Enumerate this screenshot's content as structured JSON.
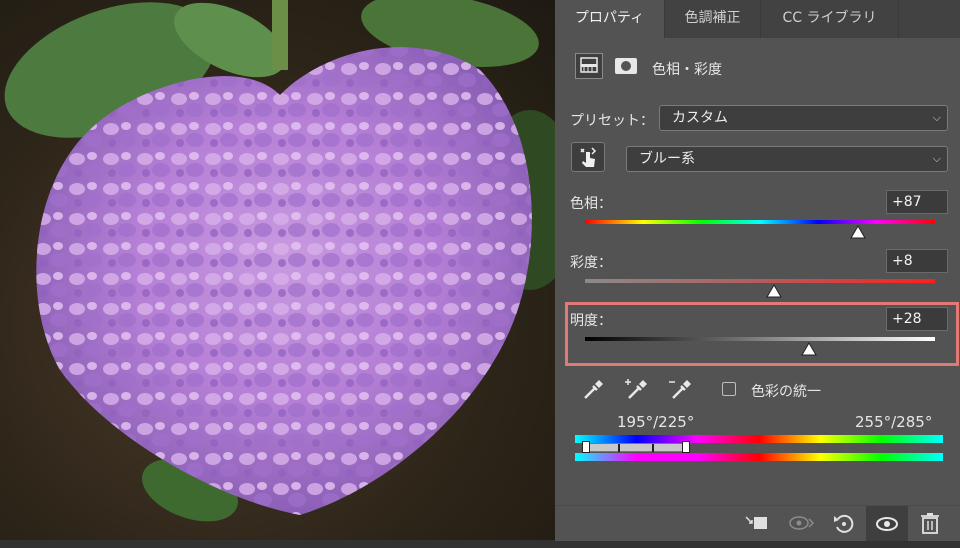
{
  "tabs": [
    {
      "label": "プロパティ",
      "active": true
    },
    {
      "label": "色調補正",
      "active": false
    },
    {
      "label": "CC ライブラリ",
      "active": false
    }
  ],
  "adjustment_title": "色相・彩度",
  "preset": {
    "label": "プリセット：",
    "value": "カスタム"
  },
  "channel": {
    "value": "ブルー系"
  },
  "sliders": [
    {
      "label": "色相：",
      "value": "+87",
      "level": 0.78
    },
    {
      "label": "彩度：",
      "value": "+8",
      "level": 0.54
    },
    {
      "label": "明度：",
      "value": "+28",
      "level": 0.64
    }
  ],
  "colorize_label": "色彩の統一",
  "range": {
    "left": "195°/225°",
    "right": "255°/285°"
  },
  "colors": {
    "highlight": "#e07a74",
    "panel": "#535353",
    "tab_bar": "#424242"
  },
  "icons": [
    "target-adjust-icon",
    "eyedropper-icon",
    "eyedropper-plus-icon",
    "eyedropper-minus-icon",
    "clip-to-layer-icon",
    "view-previous-icon",
    "reset-icon",
    "visibility-icon",
    "trash-icon"
  ]
}
